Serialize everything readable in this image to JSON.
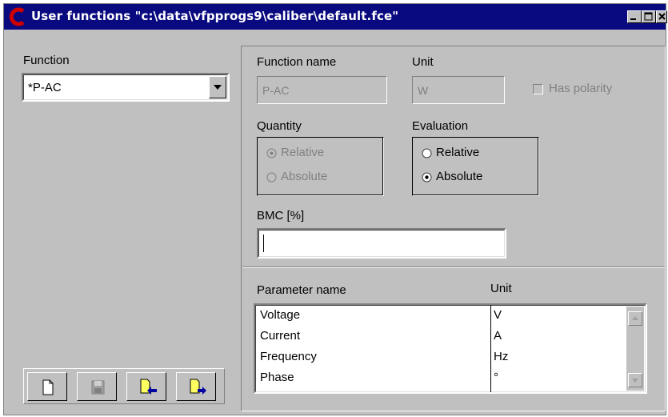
{
  "window": {
    "title": "User functions \"c:\\data\\vfpprogs9\\caliber\\default.fce\"",
    "app_icon": "caliber-c-icon",
    "title_color": "#0a0a80",
    "controls": [
      "minimize-icon",
      "maximize-icon",
      "close-icon"
    ]
  },
  "left": {
    "function_label": "Function",
    "function_value": "*P-AC",
    "toolbar": [
      {
        "name": "new-document-icon",
        "enabled": true
      },
      {
        "name": "save-disk-icon",
        "enabled": false
      },
      {
        "name": "import-file-icon",
        "enabled": true
      },
      {
        "name": "export-file-icon",
        "enabled": true
      }
    ]
  },
  "right": {
    "function_name_label": "Function name",
    "function_name_value": "P-AC",
    "unit_label": "Unit",
    "unit_value": "W",
    "has_polarity_label": "Has polarity",
    "has_polarity_checked": false,
    "quantity": {
      "label": "Quantity",
      "options": [
        "Relative",
        "Absolute"
      ],
      "selected": "Relative",
      "enabled": false
    },
    "evaluation": {
      "label": "Evaluation",
      "options": [
        "Relative",
        "Absolute"
      ],
      "selected": "Absolute",
      "enabled": true
    },
    "bmc_label": "BMC [%]",
    "bmc_value": ""
  },
  "parameters": {
    "headers": {
      "name": "Parameter name",
      "unit": "Unit"
    },
    "rows": [
      {
        "name": "Voltage",
        "unit": "V"
      },
      {
        "name": "Current",
        "unit": "A"
      },
      {
        "name": "Frequency",
        "unit": "Hz"
      },
      {
        "name": "Phase",
        "unit": "°"
      }
    ]
  }
}
